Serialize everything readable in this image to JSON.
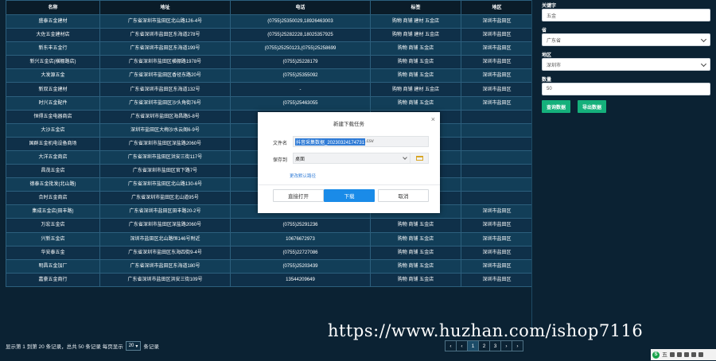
{
  "table": {
    "headers": [
      "名称",
      "地址",
      "电话",
      "标签",
      "地区"
    ],
    "rows": [
      [
        "盛泰五金建材",
        "广东省深圳市盐田区北山路126-4号",
        "(0755)25350029,18926463003",
        "购物 商铺 建材 五金店",
        "深圳市盐田区"
      ],
      [
        "大佐五金建材店",
        "广东省深圳市盐田区东海道278号",
        "(0755)25282228,18025357925",
        "购物 商铺 建材 五金店",
        "深圳市盐田区"
      ],
      [
        "新东丰五金行",
        "广东省深圳市盐田区东海道199号",
        "(0755)25250123,(0755)25258699",
        "购物 商铺 五金店",
        "深圳市盐田区"
      ],
      [
        "新兴五金店(横棚路店)",
        "广东省深圳市盐田区横棚路1978号",
        "(0755)25228179",
        "购物 商铺 五金店",
        "深圳市盐田区"
      ],
      [
        "大发源五金",
        "广东省深圳市盐田区香径东路20号",
        "(0755)25355092",
        "购物 商铺 五金店",
        "深圳市盐田区"
      ],
      [
        "新双五金建材",
        "广东省深圳市盐田区东海道132号",
        "-",
        "购物 商铺 建材 五金店",
        "深圳市盐田区"
      ],
      [
        "时兴五金配件",
        "广东省深圳市盐田区沙头角街76号",
        "(0755)25463055",
        "购物 商铺 五金店",
        "深圳市盐田区"
      ],
      [
        "恒得五金电器商店",
        "广东省深圳市盐田区海昌路5-8号",
        "",
        "",
        ""
      ],
      [
        "大沙五金店",
        "深圳市盐田区大梅沙水云阁6-9号",
        "",
        "",
        ""
      ],
      [
        "国群五金机电设备商场",
        "广东省深圳市盐田区深盐路2060号",
        "",
        "",
        ""
      ],
      [
        "大洋五金商店",
        "广东省深圳市盐田区洪安三街117号",
        "",
        "",
        ""
      ],
      [
        "昌茂五金店",
        "广东省深圳市盐田区官下路7号",
        "",
        "",
        ""
      ],
      [
        "德泰五金批发(北山路)",
        "广东省深圳市盐田区北山路130-6号",
        "",
        "",
        ""
      ],
      [
        "合时五金商店",
        "广东省深圳市盐田区北山道95号",
        "",
        "",
        ""
      ],
      [
        "集成五金店(田丰路)",
        "广东省深圳市盐田区田丰路20-2号",
        "13428955521",
        "购物 商铺 五金店",
        "深圳市盐田区"
      ],
      [
        "万宏五金店",
        "广东省深圳市盐田区深盐路2060号",
        "(0755)25291236",
        "购物 商铺 五金店",
        "深圳市盐田区"
      ],
      [
        "兴新五金店",
        "深圳市盐田区北山路恒146号附近",
        "10676672973",
        "购物 商铺 五金店",
        "深圳市盐田区"
      ],
      [
        "华安泰五金",
        "广东省深圳市盐田区东海四街9-4号",
        "(0755)22727086",
        "购物 商铺 五金店",
        "深圳市盐田区"
      ],
      [
        "明昌五金加厂",
        "广东省深圳市盐田区东海道180号",
        "(0755)25203439",
        "购物 商铺 五金店",
        "深圳市盐田区"
      ],
      [
        "嘉豪五金商行",
        "广东省深圳市盐田区洪安三街109号",
        "13544209649",
        "购物 商铺 五金店",
        "深圳市盐田区"
      ]
    ]
  },
  "pagination": {
    "info_prefix": "显示第 1 到第 20 条记录，总共 50 条记录 每页显示",
    "page_size": "20",
    "info_suffix": "条记录",
    "pages": [
      "‹",
      "‹",
      "1",
      "2",
      "3",
      "›",
      "›"
    ],
    "active_page": "1"
  },
  "sidebar": {
    "keyword_label": "关键字",
    "keyword_value": "五金",
    "province_label": "省",
    "province_value": "广东省",
    "region_label": "地区",
    "region_value": "深圳市",
    "count_label": "数量",
    "count_value": "50",
    "query_button": "查询数据",
    "export_button": "导出数据"
  },
  "dialog": {
    "title": "新建下载任务",
    "close": "×",
    "filename_label": "文件名",
    "filename_selected": "抖音采集数据_20230324174731",
    "filename_ext": ".csv",
    "dir_label": "保存到",
    "dir_value": "桌面",
    "modify_link": "更改默认路径",
    "open_button": "直接打开",
    "download_button": "下载",
    "cancel_button": "取消"
  },
  "watermark": "https://www.huzhan.com/ishop7116",
  "tray": {
    "label": "五"
  },
  "colors": {
    "background": "#0b2233",
    "accent_green": "#15b07b",
    "primary_blue": "#1a8be8"
  }
}
